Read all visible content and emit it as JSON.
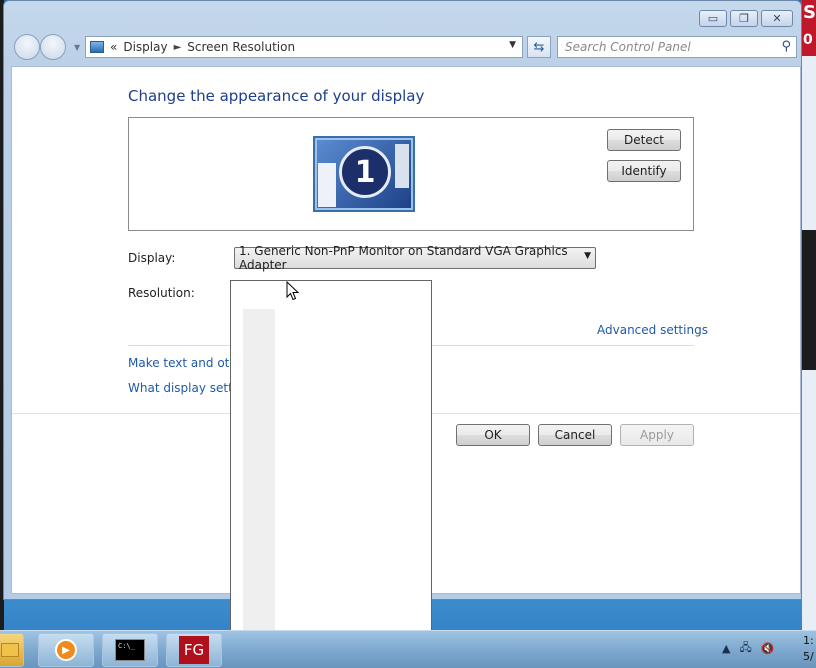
{
  "window": {
    "titlebar": {
      "minimize": "▭",
      "restore": "❐",
      "close": "✕"
    },
    "address": {
      "root_chevron": "«",
      "crumbs": [
        "Display",
        "Screen Resolution"
      ],
      "separator": "►"
    },
    "search": {
      "placeholder": "Search Control Panel"
    }
  },
  "main": {
    "heading": "Change the appearance of your display",
    "monitor_number": "1",
    "detect_label": "Detect",
    "identify_label": "Identify",
    "display_label": "Display:",
    "display_value": "1. Generic Non-PnP Monitor on Standard VGA Graphics Adapter",
    "resolution_label": "Resolution:",
    "advanced_link": "Advanced settings",
    "link_text_size": "Make text and other",
    "link_which_settings": "What display setting",
    "ok_label": "OK",
    "cancel_label": "Cancel",
    "apply_label": "Apply"
  },
  "desktop": {
    "right_edge_text": "S",
    "right_edge_sub": "0"
  },
  "taskbar": {
    "items": [
      "explorer",
      "media-player",
      "cmd",
      "fg-app"
    ],
    "cmd_label": "C:\\_",
    "fg_label": "FG",
    "clock_time": "1:",
    "clock_date": "5/"
  },
  "colors": {
    "accent_heading": "#1e3f8a",
    "link": "#1e5aa8"
  }
}
